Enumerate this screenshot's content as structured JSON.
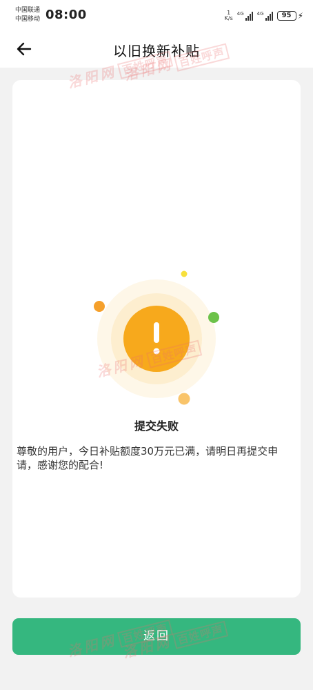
{
  "status_bar": {
    "carrier_1": "中国联通",
    "carrier_2": "中国移动",
    "time": "08:00",
    "speed_value": "1",
    "speed_unit": "K/s",
    "network_1": "4G",
    "network_2": "4G",
    "battery": "95"
  },
  "header": {
    "title": "以旧换新补贴"
  },
  "result": {
    "title": "提交失败",
    "message": "尊敬的用户，今日补贴额度30万元已满，请明日再提交申请，感谢您的配合!",
    "status_color": "#f7a91c"
  },
  "actions": {
    "return_label": "返回"
  },
  "watermark": {
    "site": "洛阳网",
    "column": "百姓呼声"
  },
  "colors": {
    "accent": "#35b77f",
    "warning": "#f7a91c",
    "decor_green": "#6cc24a"
  },
  "icons": {
    "back": "arrow-left-icon",
    "status": "exclamation-icon"
  }
}
